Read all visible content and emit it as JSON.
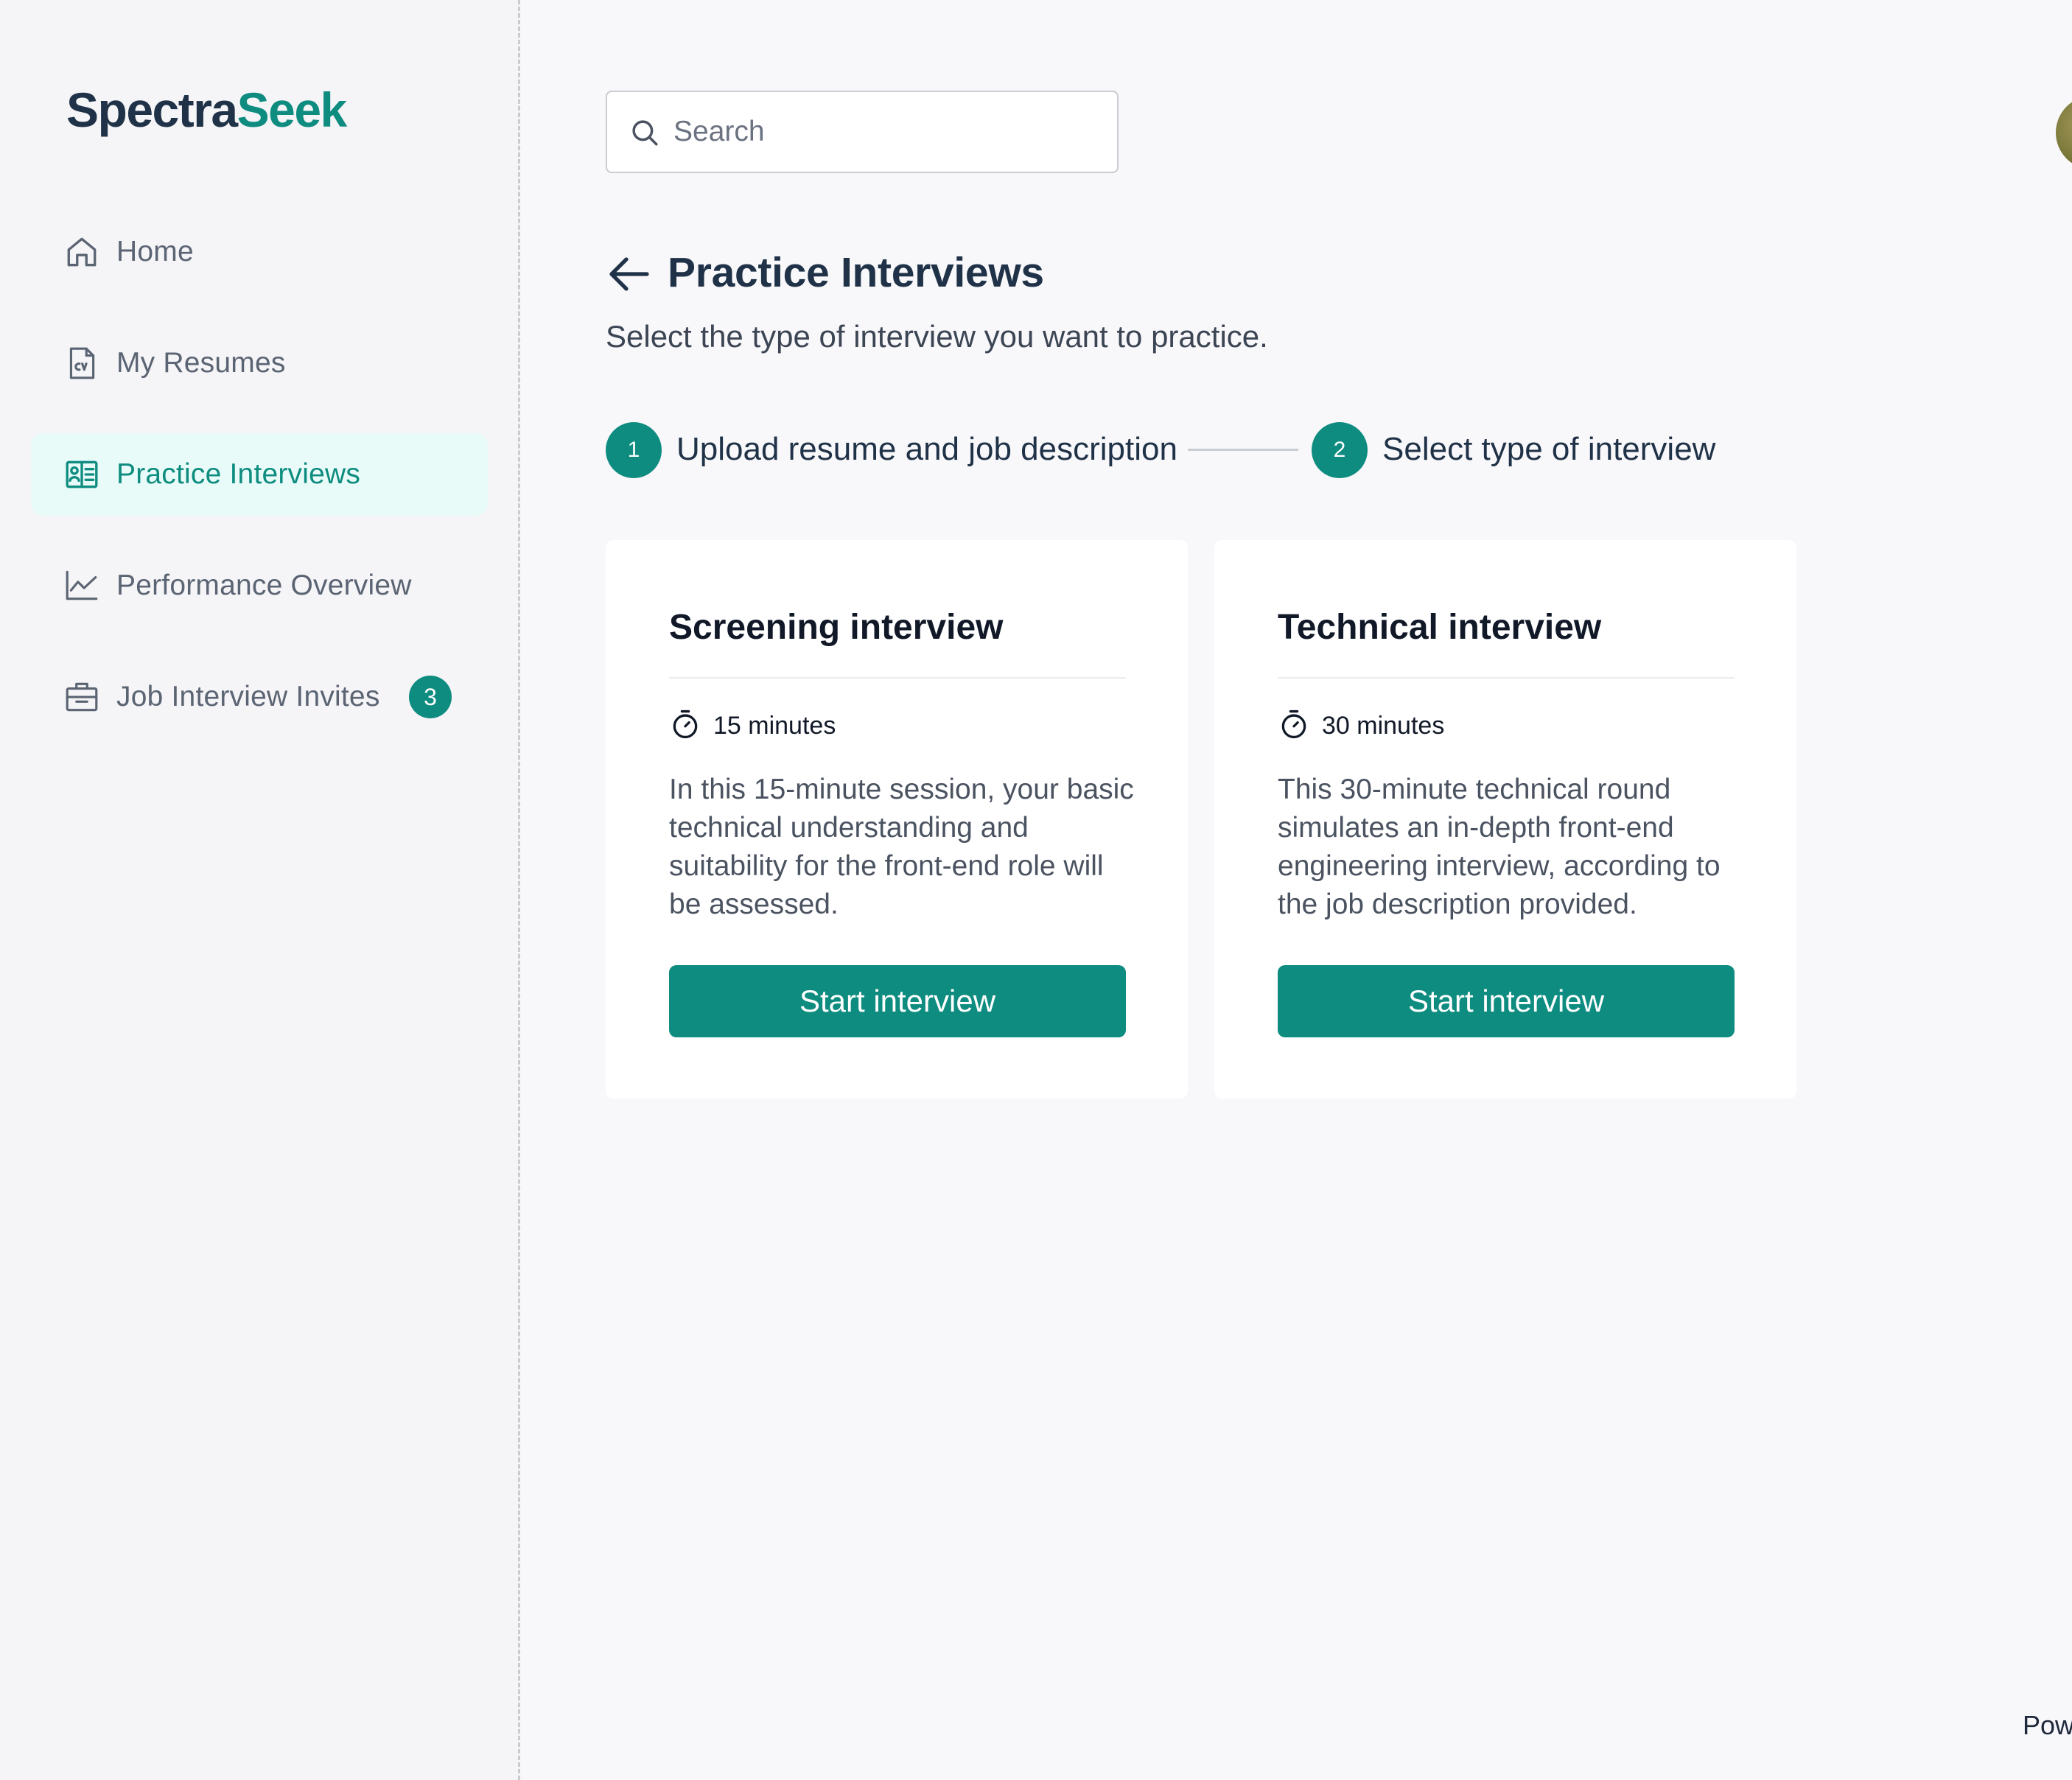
{
  "brand": {
    "name_part1": "Spectra",
    "name_part2": "Seek",
    "color_dark": "#1f3247",
    "color_accent": "#0e8c80"
  },
  "sidebar": {
    "items": [
      {
        "label": "Home",
        "icon": "home-icon",
        "active": false
      },
      {
        "label": "My Resumes",
        "icon": "cv-document-icon",
        "active": false
      },
      {
        "label": "Practice Interviews",
        "icon": "id-card-icon",
        "active": true
      },
      {
        "label": "Performance Overview",
        "icon": "line-chart-icon",
        "active": false
      },
      {
        "label": "Job Interview Invites",
        "icon": "briefcase-icon",
        "active": false,
        "badge": "3"
      }
    ]
  },
  "search": {
    "placeholder": "Search",
    "value": ""
  },
  "header": {
    "title": "Practice Interviews",
    "subtitle": "Select the type of interview you want to practice."
  },
  "stepper": {
    "steps": [
      {
        "number": "1",
        "label": "Upload resume and job description"
      },
      {
        "number": "2",
        "label": "Select type of interview"
      }
    ]
  },
  "cards": [
    {
      "title": "Screening interview",
      "duration": "15 minutes",
      "description": "In this 15-minute session, your basic technical understanding and suitability for the front-end role will be assessed.",
      "button_label": "Start interview"
    },
    {
      "title": "Technical interview",
      "duration": "30 minutes",
      "description": "This 30-minute technical round simulates an in-depth front-end engineering interview, according to the job description provided.",
      "button_label": "Start interview"
    }
  ],
  "footer": {
    "text": "Pow"
  }
}
